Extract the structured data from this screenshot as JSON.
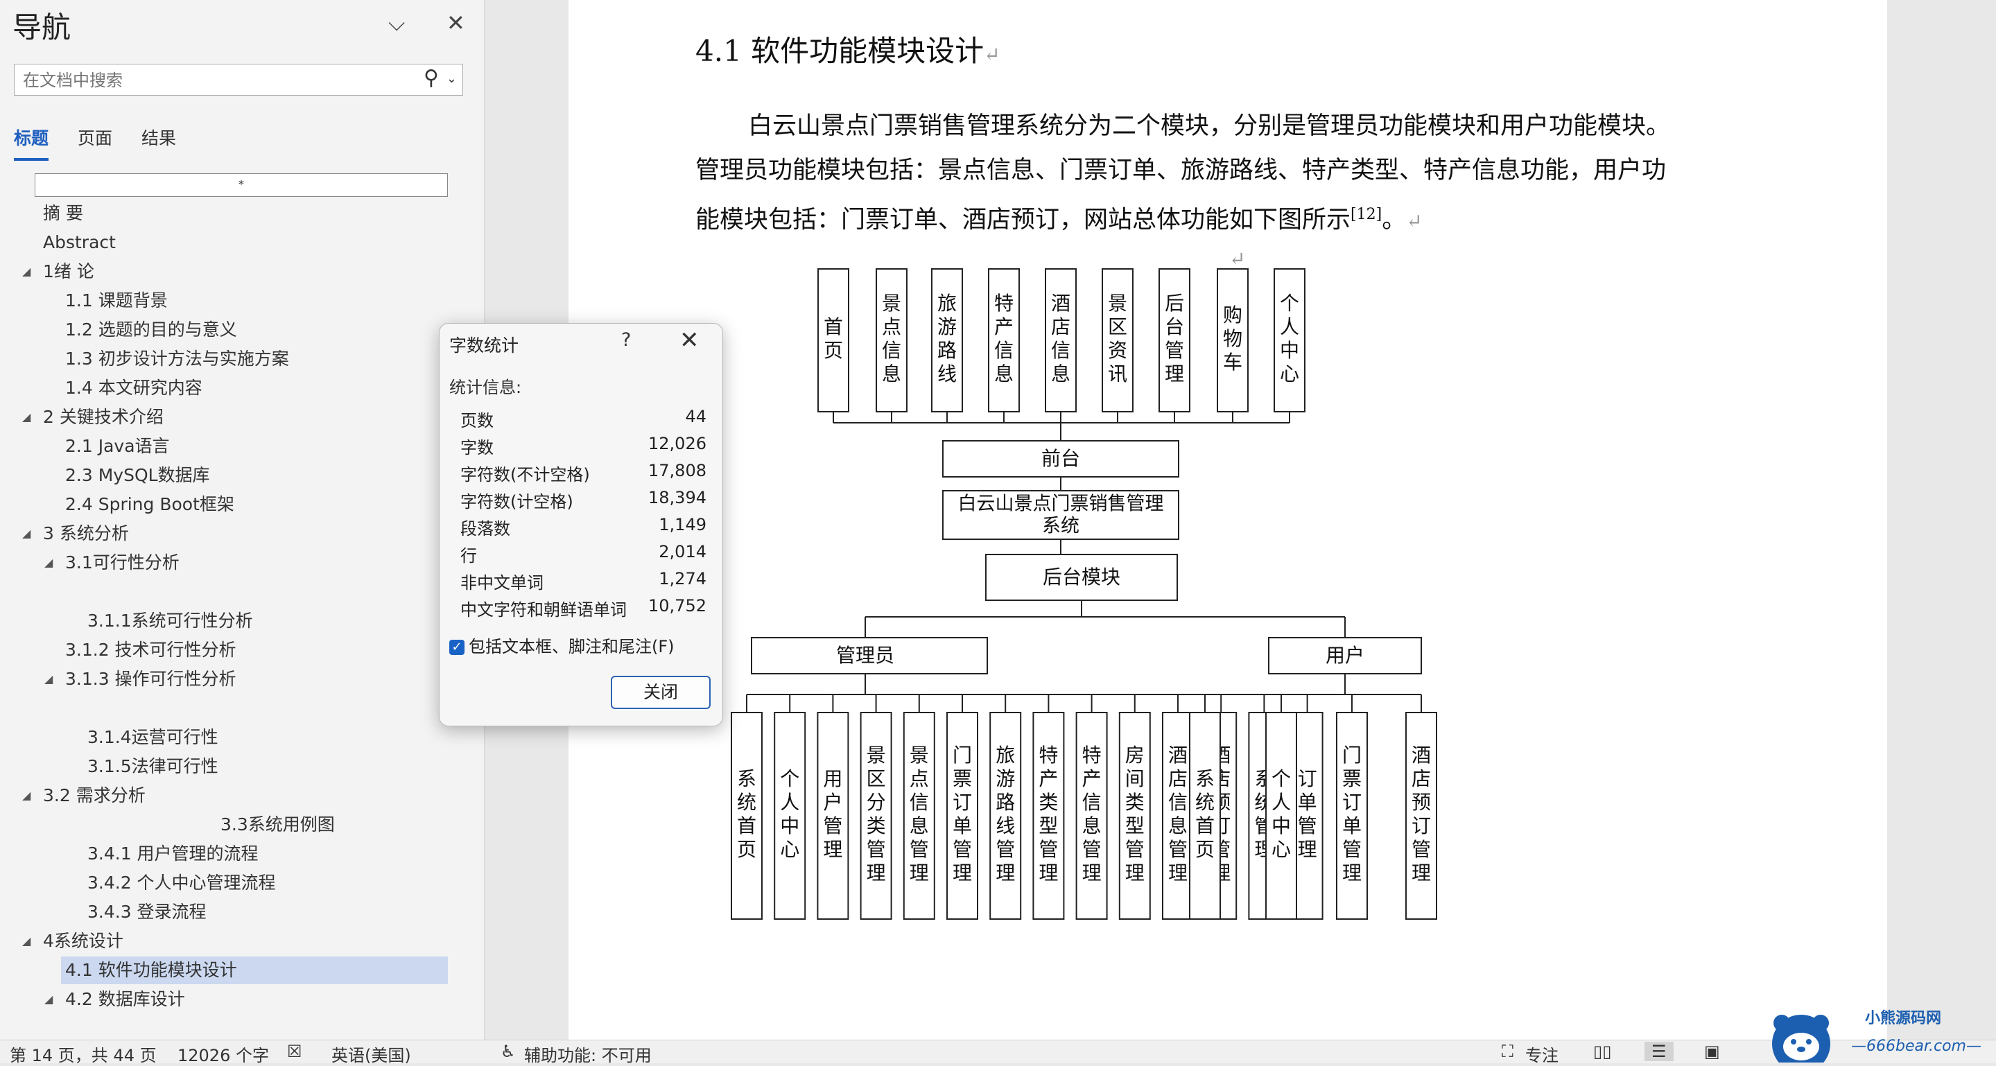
{
  "nav": {
    "title": "导航",
    "search_placeholder": "在文档中搜索",
    "tabs": [
      {
        "label": "标题",
        "active": true
      },
      {
        "label": "页面",
        "active": false
      },
      {
        "label": "结果",
        "active": false
      }
    ],
    "box_mark": "*",
    "outline": [
      {
        "label": "摘 要",
        "level": 1
      },
      {
        "label": "Abstract",
        "level": 1
      },
      {
        "label": "1绪 论",
        "level": 1,
        "expanded": true
      },
      {
        "label": "1.1 课题背景",
        "level": 2
      },
      {
        "label": "1.2 选题的目的与意义",
        "level": 2
      },
      {
        "label": "1.3 初步设计方法与实施方案",
        "level": 2
      },
      {
        "label": "1.4 本文研究内容",
        "level": 2
      },
      {
        "label": "2 关键技术介绍",
        "level": 1,
        "expanded": true
      },
      {
        "label": "2.1 Java语言",
        "level": 2
      },
      {
        "label": "2.3 MySQL数据库",
        "level": 2
      },
      {
        "label": "2.4 Spring Boot框架",
        "level": 2
      },
      {
        "label": "3 系统分析",
        "level": 1,
        "expanded": true
      },
      {
        "label": "3.1可行性分析",
        "level": 2,
        "expanded": true
      },
      {
        "label": "3.1.1系统可行性分析",
        "level": 3
      },
      {
        "label": "3.1.2 技术可行性分析",
        "level": 2
      },
      {
        "label": "3.1.3 操作可行性分析",
        "level": 2,
        "expanded": true
      },
      {
        "label": "3.1.4运营可行性",
        "level": 3
      },
      {
        "label": "3.1.5法律可行性",
        "level": 3
      },
      {
        "label": "3.2 需求分析",
        "level": 1,
        "expanded": true
      },
      {
        "label": "3.3系统用例图",
        "level": 4
      },
      {
        "label": "3.4.1 用户管理的流程",
        "level": 3
      },
      {
        "label": "3.4.2 个人中心管理流程",
        "level": 3
      },
      {
        "label": "3.4.3 登录流程",
        "level": 3
      },
      {
        "label": "4系统设计",
        "level": 1,
        "expanded": true
      },
      {
        "label": "4.1 软件功能模块设计",
        "level": 2,
        "selected": true
      },
      {
        "label": "4.2 数据库设计",
        "level": 2,
        "expanded": true
      }
    ]
  },
  "document": {
    "heading": "4.1  软件功能模块设计",
    "paragraph_lines": [
      "白云山景点门票销售管理系统分为二个模块，分别是管理员功能模块和用户功能模块。",
      "管理员功能模块包括：景点信息、门票订单、旅游路线、特产类型、特产信息功能，用户功",
      "能模块包括：门票订单、酒店预订，网站总体功能如下图所示"
    ],
    "citation": "[12]",
    "paragraph_end": "。",
    "return_mark": "↵"
  },
  "diagram": {
    "front_modules": [
      "首页",
      "景点信息",
      "旅游路线",
      "特产信息",
      "酒店信息",
      "景区资讯",
      "后台管理",
      "购物车",
      "个人中心"
    ],
    "front_node": "前台",
    "system_node_line1": "白云山景点门票销售管理",
    "system_node_line2": "系统",
    "backend_node": "后台模块",
    "admin_node": "管理员",
    "user_node": "用户",
    "admin_modules": [
      "系统首页",
      "个人中心",
      "用户管理",
      "景区分类管理",
      "景点信息管理",
      "门票订单管理",
      "旅游路线管理",
      "特产类型管理",
      "特产信息管理",
      "房间类型管理",
      "酒店信息管理",
      "酒店预订管理",
      "系统管理",
      "订单管理"
    ],
    "user_modules": [
      "系统首页",
      "个人中心",
      "门票订单管理",
      "酒店预订管理"
    ]
  },
  "dialog": {
    "title": "字数统计",
    "help": "?",
    "close_x": "✕",
    "section": "统计信息:",
    "stats": [
      {
        "label": "页数",
        "value": "44"
      },
      {
        "label": "字数",
        "value": "12,026"
      },
      {
        "label": "字符数(不计空格)",
        "value": "17,808"
      },
      {
        "label": "字符数(计空格)",
        "value": "18,394"
      },
      {
        "label": "段落数",
        "value": "1,149"
      },
      {
        "label": "行",
        "value": "2,014"
      },
      {
        "label": "非中文单词",
        "value": "1,274"
      },
      {
        "label": "中文字符和朝鲜语单词",
        "value": "10,752"
      }
    ],
    "checkbox_label": "包括文本框、脚注和尾注(F)",
    "checkbox_checked": true,
    "close_button": "关闭"
  },
  "status": {
    "page": "第 14 页，共 44 页",
    "words": "12026 个字",
    "language": "英语(美国)",
    "accessibility": "辅助功能: 不可用",
    "focus": "专注"
  },
  "watermark": {
    "name": "小熊源码网",
    "url": "—666bear.com—"
  },
  "colors": {
    "accent": "#1f5fbf",
    "selected_item": "#cbd8f0",
    "checkbox": "#1a63c6"
  }
}
